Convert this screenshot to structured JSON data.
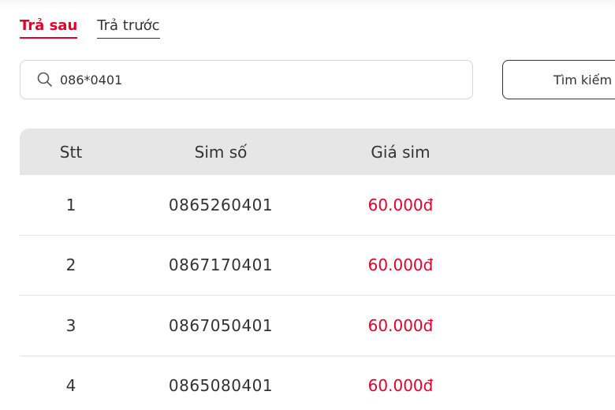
{
  "tabs": [
    {
      "label": "Trả sau",
      "active": true
    },
    {
      "label": "Trả trước",
      "active": false
    }
  ],
  "search": {
    "value": "086*0401",
    "button_label": "Tìm kiếm"
  },
  "table": {
    "headers": {
      "stt": "Stt",
      "sim": "Sim số",
      "price": "Giá sim"
    },
    "rows": [
      {
        "stt": "1",
        "sim": "0865260401",
        "price": "60.000đ"
      },
      {
        "stt": "2",
        "sim": "0867170401",
        "price": "60.000đ"
      },
      {
        "stt": "3",
        "sim": "0867050401",
        "price": "60.000đ"
      },
      {
        "stt": "4",
        "sim": "0865080401",
        "price": "60.000đ"
      }
    ]
  },
  "colors": {
    "accent": "#e2002a",
    "header_bg": "#e6e6e6",
    "text": "#333333"
  },
  "icons": {
    "search": "search-icon"
  }
}
